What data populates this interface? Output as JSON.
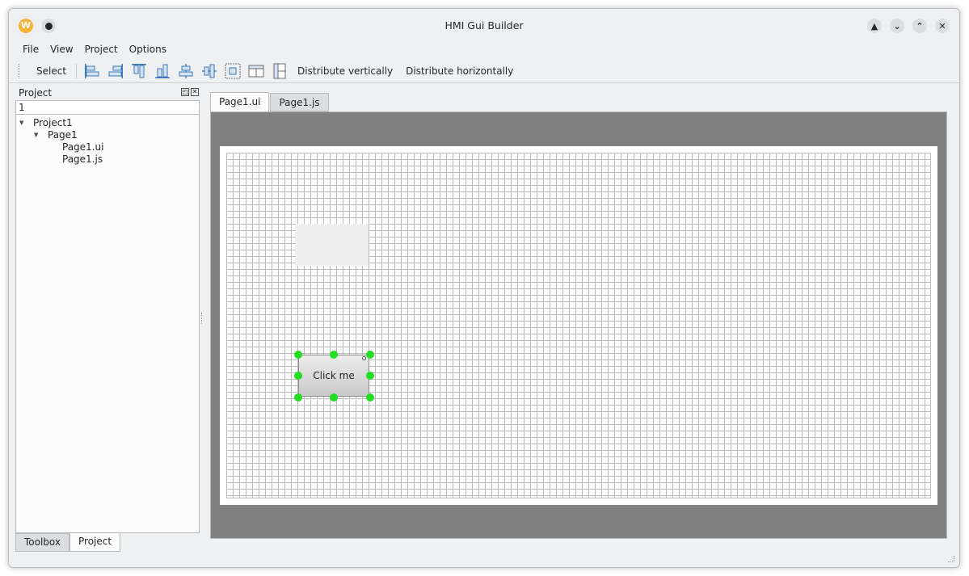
{
  "window": {
    "title": "HMI Gui Builder",
    "app_icon_letter": "W",
    "controls": [
      "minimize-icon",
      "maximize-icon",
      "keep-above-icon",
      "close-icon"
    ]
  },
  "menubar": {
    "items": [
      "File",
      "View",
      "Project",
      "Options"
    ]
  },
  "toolbar": {
    "select_label": "Select",
    "align_icons": [
      "align-left-icon",
      "align-right-icon",
      "align-top-icon",
      "align-bottom-icon",
      "align-center-horizontal-icon",
      "align-center-vertical-icon",
      "center-in-parent-icon",
      "equal-size-horizontal-icon",
      "equal-size-vertical-icon"
    ],
    "distribute_vertically": "Distribute vertically",
    "distribute_horizontally": "Distribute horizontally"
  },
  "project_dock": {
    "title": "Project",
    "search_value": "1",
    "tree": {
      "project": "Project1",
      "page": "Page1",
      "files": [
        "Page1.ui",
        "Page1.js"
      ]
    },
    "tabs": [
      "Toolbox",
      "Project"
    ],
    "active_tab": "Project"
  },
  "editor": {
    "tabs": [
      "Page1.ui",
      "Page1.js"
    ],
    "active_tab": "Page1.ui",
    "button_label": "Click me",
    "handle_color": "#22dd22"
  }
}
